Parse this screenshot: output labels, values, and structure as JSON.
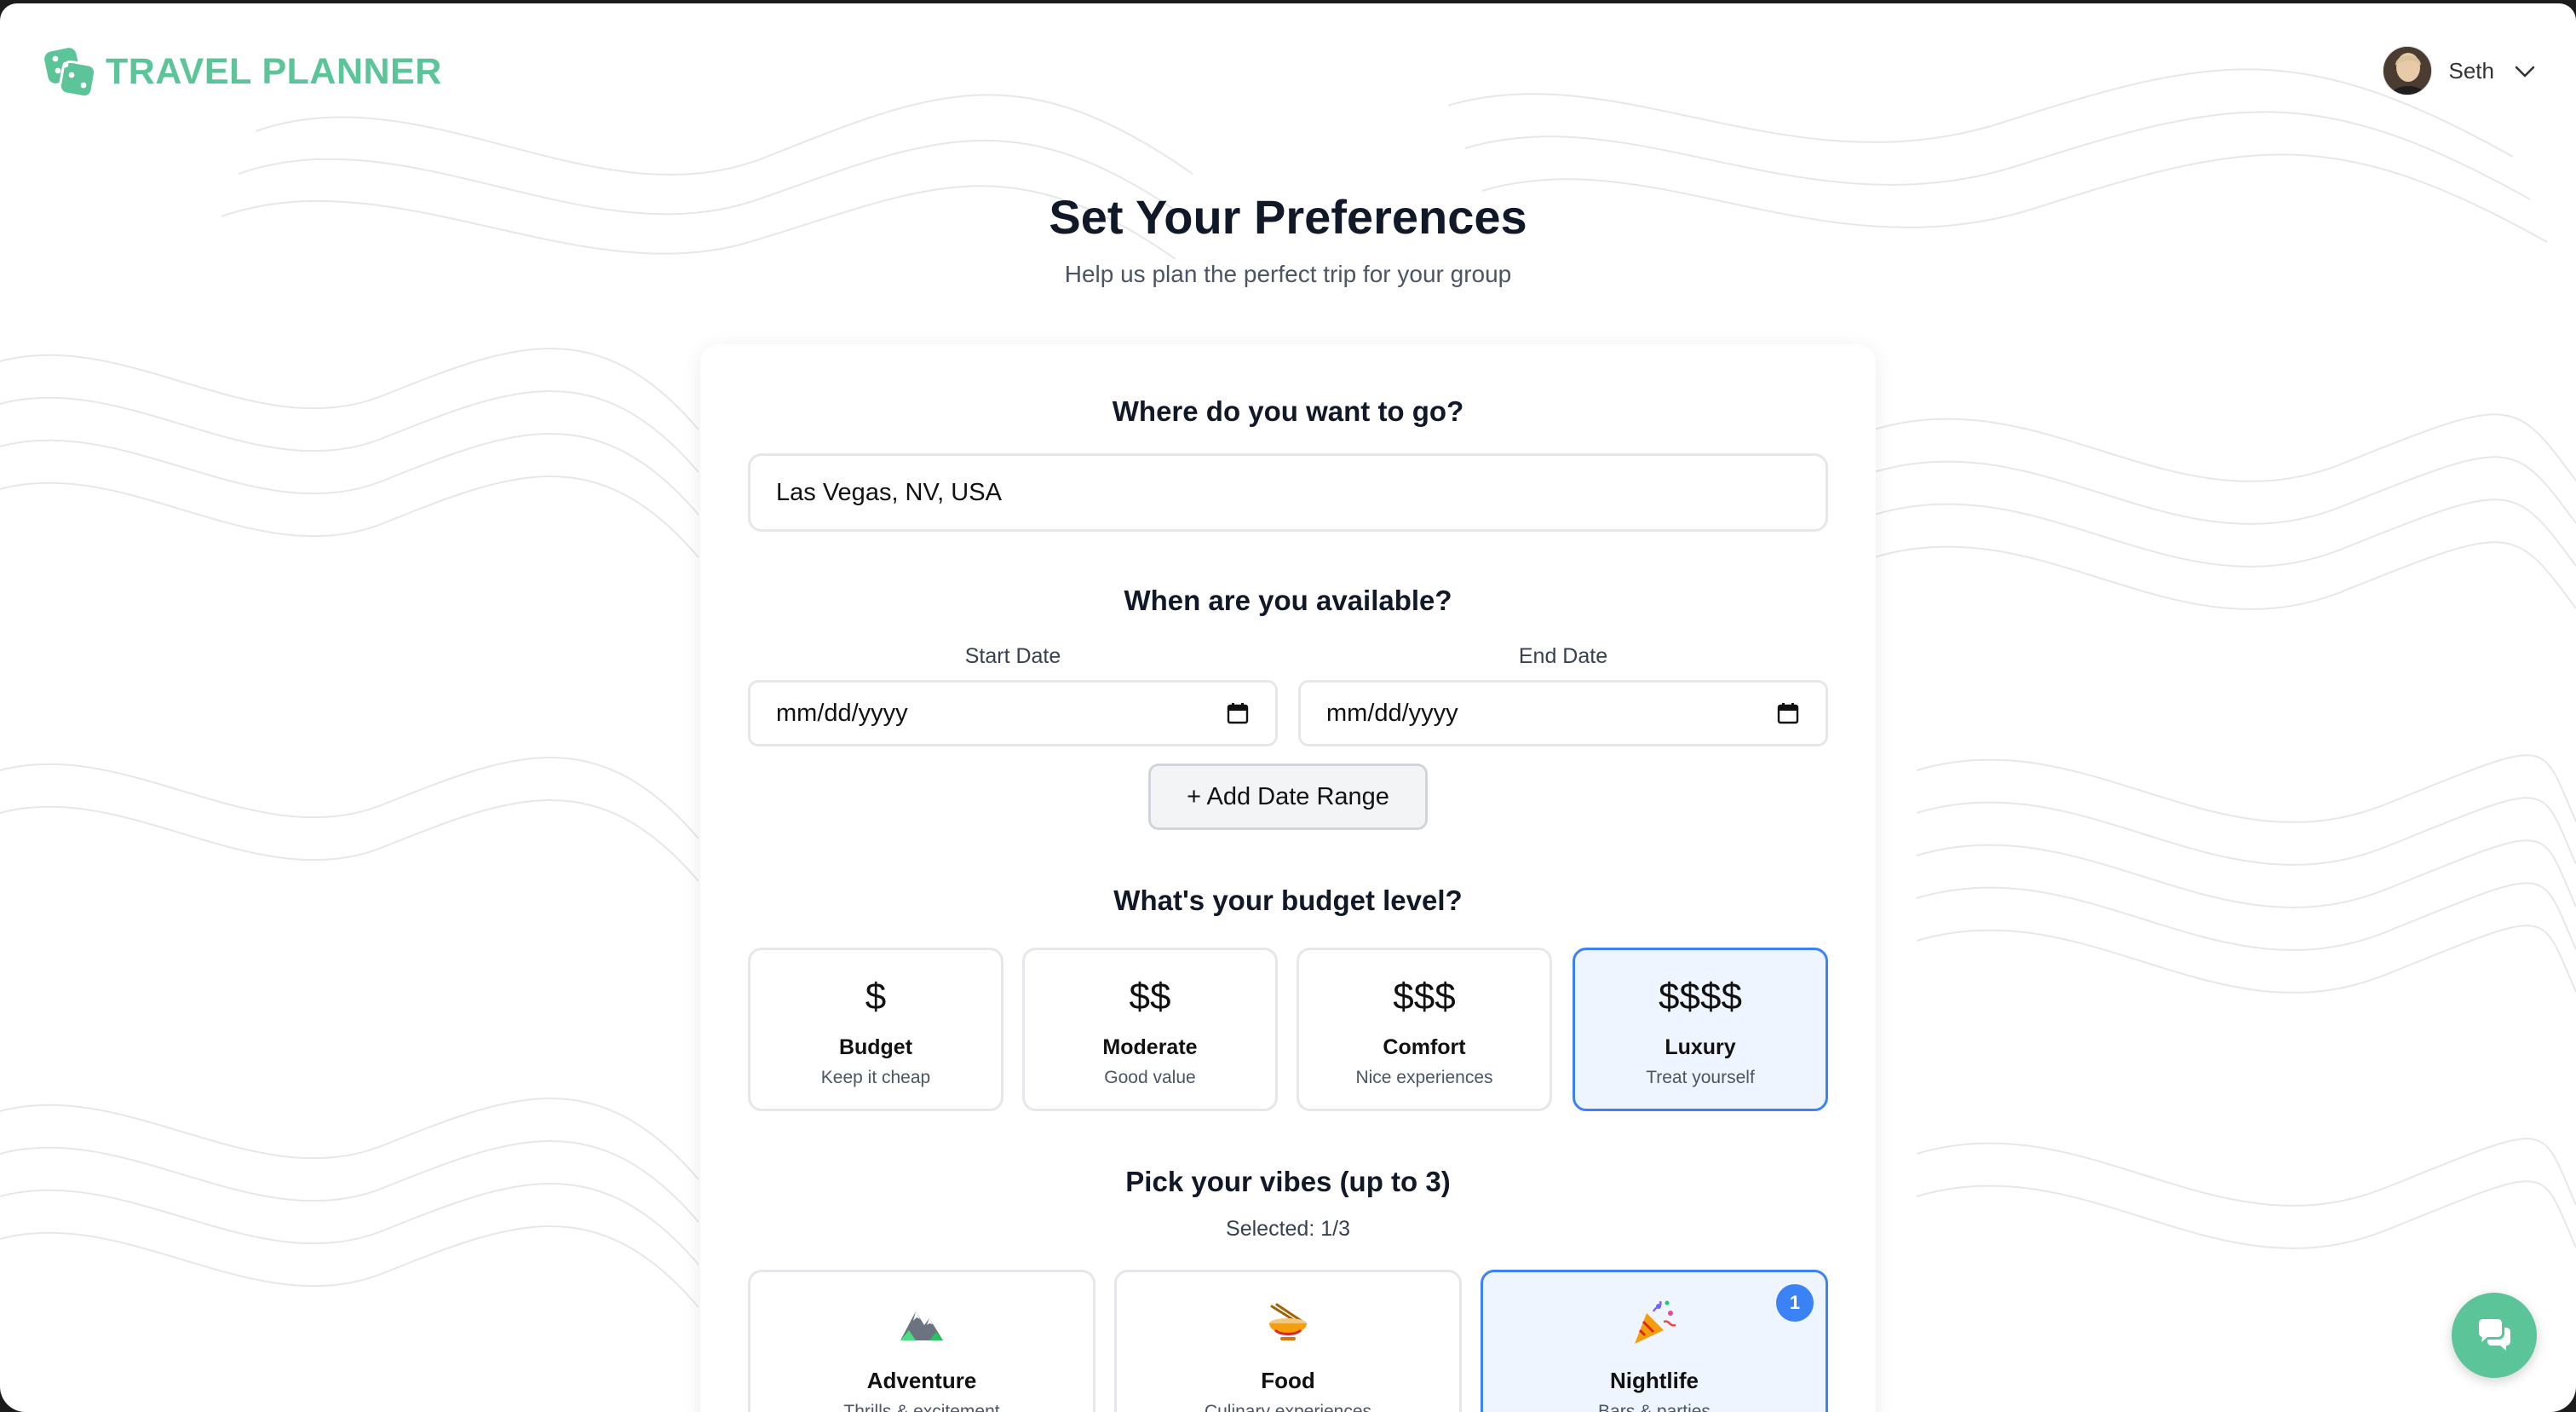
{
  "app": {
    "name": "TRAVEL PLANNER",
    "brand_color": "#5bc498"
  },
  "user": {
    "name": "Seth"
  },
  "page": {
    "title": "Set Your Preferences",
    "subtitle": "Help us plan the perfect trip for your group"
  },
  "destination": {
    "question": "Where do you want to go?",
    "value": "Las Vegas, NV, USA"
  },
  "availability": {
    "question": "When are you available?",
    "start_label": "Start Date",
    "start_value": "mm/dd/yyyy",
    "end_label": "End Date",
    "end_value": "mm/dd/yyyy",
    "add_range_label": "+ Add Date Range"
  },
  "budget": {
    "question": "What's your budget level?",
    "selected": "Luxury",
    "options": [
      {
        "symbol": "$",
        "name": "Budget",
        "desc": "Keep it cheap"
      },
      {
        "symbol": "$$",
        "name": "Moderate",
        "desc": "Good value"
      },
      {
        "symbol": "$$$",
        "name": "Comfort",
        "desc": "Nice experiences"
      },
      {
        "symbol": "$$$$",
        "name": "Luxury",
        "desc": "Treat yourself"
      }
    ]
  },
  "vibes": {
    "question": "Pick your vibes (up to 3)",
    "selected_count": "Selected: 1/3",
    "options": [
      {
        "icon": "mountain-icon",
        "name": "Adventure",
        "desc": "Thrills & excitement"
      },
      {
        "icon": "ramen-bowl-icon",
        "name": "Food",
        "desc": "Culinary experiences"
      },
      {
        "icon": "party-popper-icon",
        "name": "Nightlife",
        "desc": "Bars & parties",
        "badge": "1"
      }
    ]
  },
  "colors": {
    "accent": "#3b82f6",
    "selected_bg": "#eef5ff"
  }
}
